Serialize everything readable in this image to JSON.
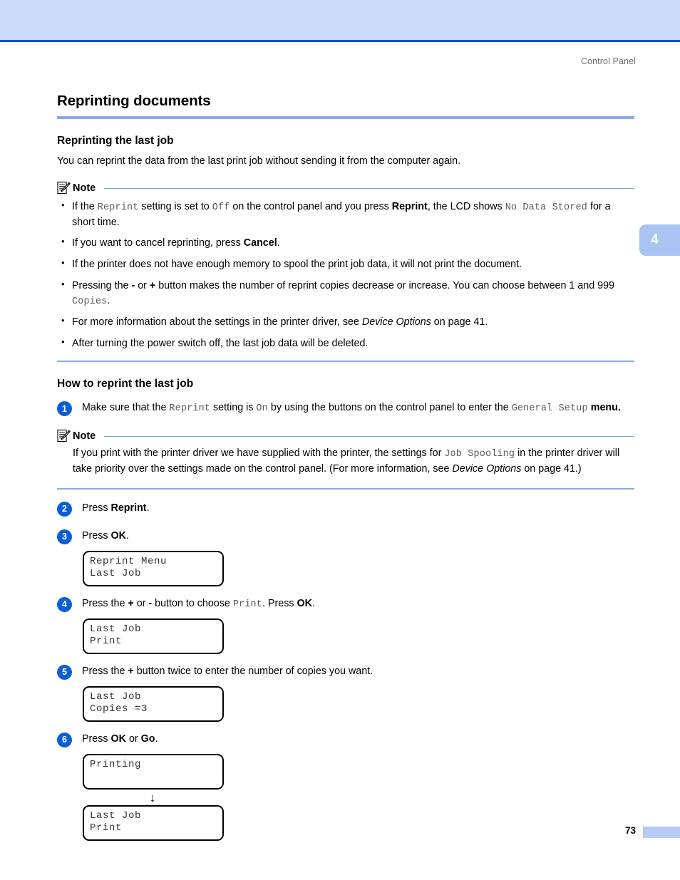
{
  "header": {
    "running_head": "Control Panel",
    "chapter_tab": "4"
  },
  "footer": {
    "page_number": "73"
  },
  "main": {
    "title": "Reprinting documents",
    "section1": {
      "heading": "Reprinting the last job",
      "intro": "You can reprint the data from the last print job without sending it from the computer again.",
      "note": {
        "label": "Note",
        "bullets": [
          {
            "parts": [
              {
                "t": "If the ",
                "s": "plain"
              },
              {
                "t": "Reprint",
                "s": "mono"
              },
              {
                "t": " setting is set to ",
                "s": "plain"
              },
              {
                "t": "Off",
                "s": "mono"
              },
              {
                "t": " on the control panel and you press ",
                "s": "plain"
              },
              {
                "t": "Reprint",
                "s": "bold"
              },
              {
                "t": ", the LCD shows ",
                "s": "plain"
              },
              {
                "t": "No Data Stored",
                "s": "mono"
              },
              {
                "t": " for a short time.",
                "s": "plain"
              }
            ]
          },
          {
            "parts": [
              {
                "t": "If you want to cancel reprinting, press ",
                "s": "plain"
              },
              {
                "t": "Cancel",
                "s": "bold"
              },
              {
                "t": ".",
                "s": "plain"
              }
            ]
          },
          {
            "parts": [
              {
                "t": "If the printer does not have enough memory to spool the print job data, it will not print the document.",
                "s": "plain"
              }
            ]
          },
          {
            "parts": [
              {
                "t": "Pressing the ",
                "s": "plain"
              },
              {
                "t": "-",
                "s": "bold"
              },
              {
                "t": " or ",
                "s": "plain"
              },
              {
                "t": "+",
                "s": "bold"
              },
              {
                "t": " button makes the number of reprint copies decrease or increase. You can choose between 1 and 999 ",
                "s": "plain"
              },
              {
                "t": "Copies",
                "s": "mono"
              },
              {
                "t": ".",
                "s": "plain"
              }
            ]
          },
          {
            "parts": [
              {
                "t": "For more information about the settings in the printer driver, see ",
                "s": "plain"
              },
              {
                "t": "Device Options",
                "s": "ital"
              },
              {
                "t": " on page 41.",
                "s": "plain"
              }
            ]
          },
          {
            "parts": [
              {
                "t": "After turning the power switch off, the last job data will be deleted.",
                "s": "plain"
              }
            ]
          }
        ]
      }
    },
    "section2": {
      "heading": "How to reprint the last job",
      "steps": [
        {
          "num": "1",
          "parts": [
            {
              "t": "Make sure that the ",
              "s": "plain"
            },
            {
              "t": "Reprint",
              "s": "mono"
            },
            {
              "t": " setting is ",
              "s": "plain"
            },
            {
              "t": "On",
              "s": "mono"
            },
            {
              "t": " by using the buttons on the control panel to enter the ",
              "s": "plain"
            },
            {
              "t": "General Setup",
              "s": "mono"
            },
            {
              "t": " menu.",
              "s": "bold"
            }
          ],
          "lcd": null
        },
        {
          "num": "2",
          "parts": [
            {
              "t": "Press ",
              "s": "plain"
            },
            {
              "t": "Reprint",
              "s": "bold"
            },
            {
              "t": ".",
              "s": "plain"
            }
          ],
          "lcd": null
        },
        {
          "num": "3",
          "parts": [
            {
              "t": "Press ",
              "s": "plain"
            },
            {
              "t": "OK",
              "s": "bold"
            },
            {
              "t": ".",
              "s": "plain"
            }
          ],
          "lcd": [
            "Reprint Menu",
            "Last Job"
          ]
        },
        {
          "num": "4",
          "parts": [
            {
              "t": "Press the ",
              "s": "plain"
            },
            {
              "t": "+",
              "s": "bold"
            },
            {
              "t": " or ",
              "s": "plain"
            },
            {
              "t": "-",
              "s": "bold"
            },
            {
              "t": " button to choose ",
              "s": "plain"
            },
            {
              "t": "Print",
              "s": "mono"
            },
            {
              "t": ". Press ",
              "s": "plain"
            },
            {
              "t": "OK",
              "s": "bold"
            },
            {
              "t": ".",
              "s": "plain"
            }
          ],
          "lcd": [
            "Last Job",
            "Print"
          ]
        },
        {
          "num": "5",
          "parts": [
            {
              "t": "Press the ",
              "s": "plain"
            },
            {
              "t": "+",
              "s": "bold"
            },
            {
              "t": " button twice to enter the number of copies you want.",
              "s": "plain"
            }
          ],
          "lcd": [
            "Last Job",
            "Copies =3"
          ]
        },
        {
          "num": "6",
          "parts": [
            {
              "t": "Press ",
              "s": "plain"
            },
            {
              "t": "OK",
              "s": "bold"
            },
            {
              "t": " or ",
              "s": "plain"
            },
            {
              "t": "Go",
              "s": "bold"
            },
            {
              "t": ".",
              "s": "plain"
            }
          ],
          "lcd": [
            "Printing",
            ""
          ],
          "arrow": "↓",
          "lcd2": [
            "Last Job",
            "Print"
          ]
        }
      ],
      "note": {
        "label": "Note",
        "body_parts": [
          {
            "t": "If you print with the printer driver we have supplied with the printer, the settings for ",
            "s": "plain"
          },
          {
            "t": "Job Spooling",
            "s": "mono"
          },
          {
            "t": " in the printer driver will take priority over the settings made on the control panel. (For more information, see ",
            "s": "plain"
          },
          {
            "t": "Device Options",
            "s": "ital"
          },
          {
            "t": " on page 41.)",
            "s": "plain"
          }
        ]
      }
    }
  },
  "colors": {
    "banner_fill": "#ccdbf7",
    "banner_rule": "#0050d8",
    "heading_rule": "#86aaea",
    "step_circle": "#0b5fd2",
    "tab_fill": "#a9c3f2",
    "mono_text": "#585858"
  }
}
